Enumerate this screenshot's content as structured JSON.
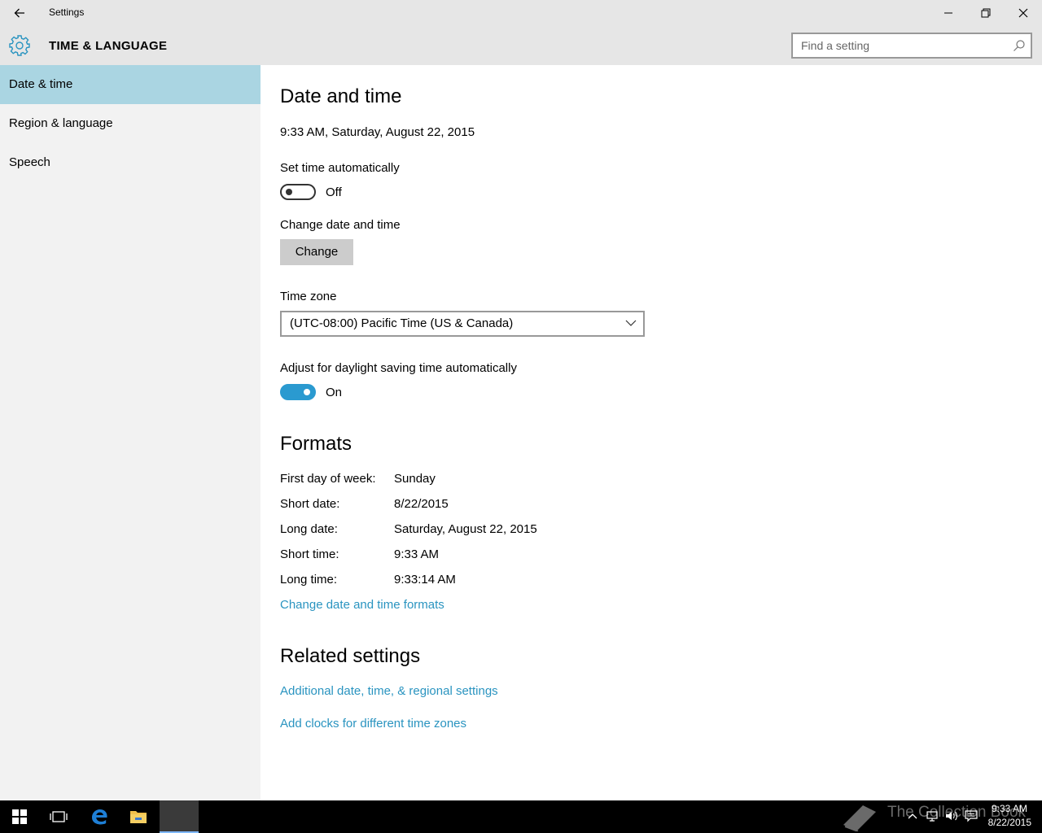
{
  "window": {
    "title": "Settings"
  },
  "header": {
    "section_title": "TIME & LANGUAGE",
    "search_placeholder": "Find a setting"
  },
  "sidebar": {
    "items": [
      {
        "label": "Date & time",
        "active": true
      },
      {
        "label": "Region & language",
        "active": false
      },
      {
        "label": "Speech",
        "active": false
      }
    ]
  },
  "main": {
    "date_and_time_heading": "Date and time",
    "current_datetime": "9:33 AM, Saturday, August 22, 2015",
    "set_time_auto": {
      "label": "Set time automatically",
      "state": "Off"
    },
    "change_date_time": {
      "label": "Change date and time",
      "button": "Change"
    },
    "time_zone": {
      "label": "Time zone",
      "value": "(UTC-08:00) Pacific Time (US & Canada)"
    },
    "daylight_saving": {
      "label": "Adjust for daylight saving time automatically",
      "state": "On"
    },
    "formats": {
      "heading": "Formats",
      "rows": [
        {
          "label": "First day of week:",
          "value": "Sunday"
        },
        {
          "label": "Short date:",
          "value": "8/22/2015"
        },
        {
          "label": "Long date:",
          "value": "Saturday, August 22, 2015"
        },
        {
          "label": "Short time:",
          "value": "9:33 AM"
        },
        {
          "label": "Long time:",
          "value": "9:33:14 AM"
        }
      ],
      "change_link": "Change date and time formats"
    },
    "related": {
      "heading": "Related settings",
      "links": [
        "Additional date, time, & regional settings",
        "Add clocks for different time zones"
      ]
    }
  },
  "taskbar": {
    "watermark": "The Collection Book",
    "clock_time": "9:33 AM",
    "clock_date": "8/22/2015"
  },
  "colors": {
    "accent": "#2a94c0",
    "selected_nav": "#aad5e2",
    "toggle_on": "#2a9ad0"
  }
}
